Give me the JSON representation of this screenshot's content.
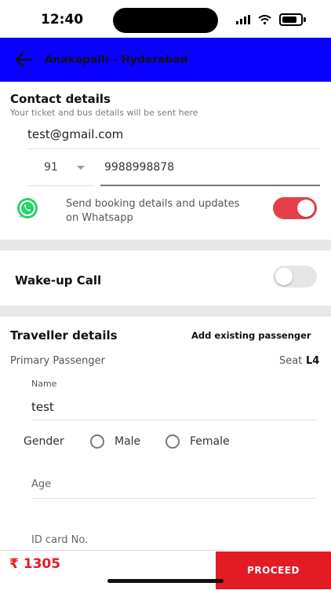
{
  "status": {
    "time": "12:40"
  },
  "header": {
    "title": "Anakapalli - Hyderabad"
  },
  "contact": {
    "title": "Contact details",
    "subtitle": "Your ticket and bus details will be sent here",
    "email": "test@gmail.com",
    "country_code": "91",
    "phone": "9988998878",
    "whatsapp_text_line1": "Send booking details and updates",
    "whatsapp_text_line2": "on Whatsapp",
    "whatsapp_enabled": true
  },
  "wakeup": {
    "label": "Wake-up Call",
    "enabled": false
  },
  "traveller": {
    "title": "Traveller details",
    "add_existing": "Add existing passenger",
    "primary": "Primary Passenger",
    "seat_label": "Seat",
    "seat_value": "L4",
    "name_label": "Name",
    "name_value": "test",
    "gender_label": "Gender",
    "gender_male": "Male",
    "gender_female": "Female",
    "age_placeholder": "Age",
    "id_placeholder": "ID card No."
  },
  "footer": {
    "price": "₹ 1305",
    "proceed": "PROCEED"
  },
  "colors": {
    "brand_blue": "#0a00ff",
    "accent_red": "#e31b23",
    "whatsapp_green": "#25d366"
  }
}
